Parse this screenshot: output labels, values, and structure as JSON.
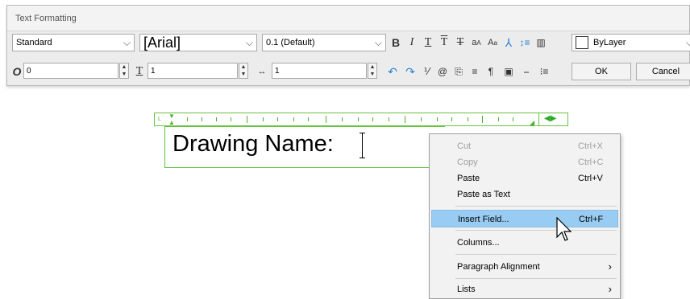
{
  "window": {
    "title": "Text Formatting"
  },
  "toolbar": {
    "style": "Standard",
    "font": "[Arial]",
    "height": "0.1 (Default)",
    "color": "ByLayer",
    "oblique": "0",
    "tracking": "1",
    "width_factor": "1",
    "ok_label": "OK",
    "cancel_label": "Cancel"
  },
  "editor": {
    "text": "Drawing Name:"
  },
  "context_menu": {
    "items": [
      {
        "label": "Cut",
        "shortcut": "Ctrl+X",
        "disabled": true
      },
      {
        "label": "Copy",
        "shortcut": "Ctrl+C",
        "disabled": true
      },
      {
        "label": "Paste",
        "shortcut": "Ctrl+V"
      },
      {
        "label": "Paste as Text",
        "shortcut": ""
      },
      {
        "label": "Insert Field...",
        "shortcut": "Ctrl+F",
        "highlighted": true
      },
      {
        "label": "Columns...",
        "shortcut": ""
      },
      {
        "label": "Paragraph Alignment",
        "shortcut": ""
      },
      {
        "label": "Lists",
        "shortcut": ""
      }
    ]
  },
  "colors": {
    "ruler_green": "#67c33f",
    "highlight": "#99ccf2"
  }
}
